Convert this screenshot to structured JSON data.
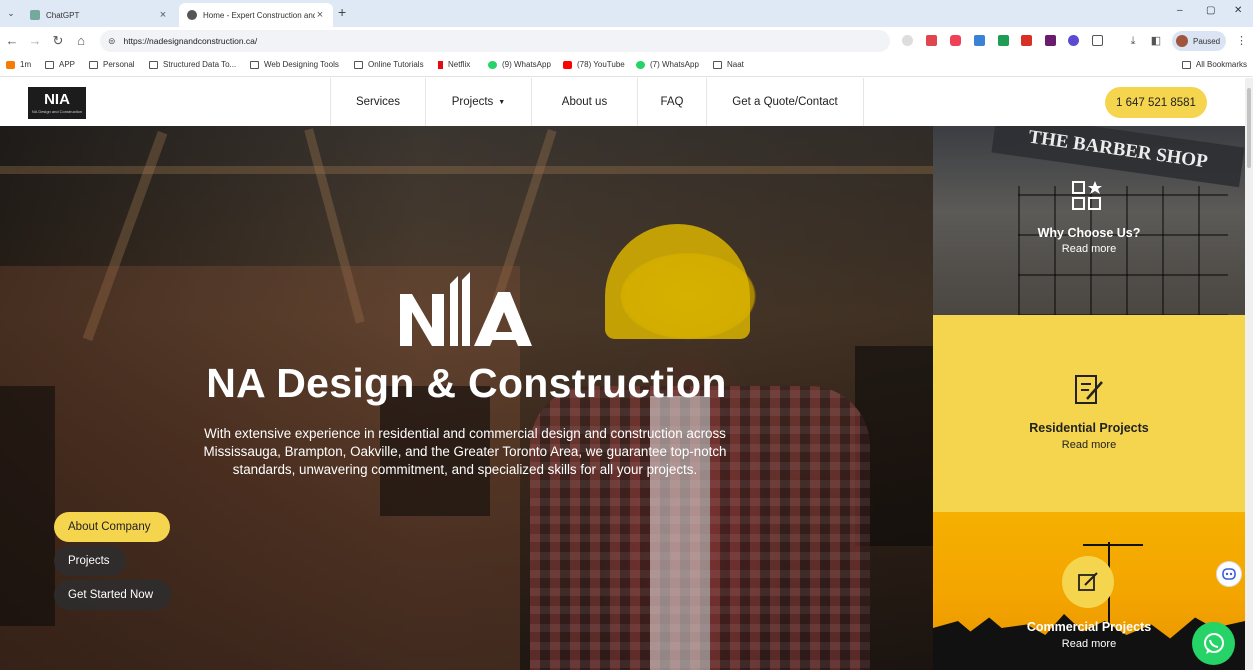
{
  "browser": {
    "tabs": [
      {
        "title": "ChatGPT",
        "close": "×"
      },
      {
        "title": "Home - Expert Construction and",
        "close": "×"
      }
    ],
    "new_tab": "+",
    "window_controls": {
      "minimize": "–",
      "maximize": "▢",
      "close": "✕"
    },
    "url": "https://nadesignandconstruction.ca/",
    "profile_status": "Paused",
    "bookmarks": [
      {
        "label": "1m",
        "icon": "orange-app-icon"
      },
      {
        "label": "APP",
        "icon": "folder-icon"
      },
      {
        "label": "Personal",
        "icon": "folder-icon"
      },
      {
        "label": "Structured Data To...",
        "icon": "folder-icon"
      },
      {
        "label": "Web Designing Tools",
        "icon": "folder-icon"
      },
      {
        "label": "Online Tutorials",
        "icon": "folder-icon"
      },
      {
        "label": "Netflix",
        "icon": "netflix-icon"
      },
      {
        "label": "(9) WhatsApp",
        "icon": "whatsapp-icon"
      },
      {
        "label": "(78) YouTube",
        "icon": "youtube-icon"
      },
      {
        "label": "(7) WhatsApp",
        "icon": "whatsapp-icon"
      },
      {
        "label": "Naat",
        "icon": "folder-icon"
      }
    ],
    "all_bookmarks": "All Bookmarks"
  },
  "site": {
    "logo_mark": "NIA",
    "logo_sub": "NA Design and Construction",
    "nav": [
      "Services",
      "Projects",
      "About us",
      "FAQ",
      "Get a Quote/Contact"
    ],
    "phone": "1 647 521 8581"
  },
  "hero": {
    "title": "NA Design & Construction",
    "description": "With extensive experience in residential and commercial design and construction across Mississauga, Brampton, Oakville, and the Greater Toronto Area, we guarantee top-notch standards, unwavering commitment, and specialized skills for all your projects.",
    "buttons": [
      "About Company",
      "Projects",
      "Get Started Now"
    ]
  },
  "side_cards": [
    {
      "title": "Why Choose Us?",
      "link": "Read more",
      "icon": "grid-star-icon",
      "sign": "THE BARBER SHOP"
    },
    {
      "title": "Residential Projects",
      "link": "Read more",
      "icon": "document-edit-icon"
    },
    {
      "title": "Commercial Projects",
      "link": "Read more",
      "icon": "edit-square-icon"
    }
  ],
  "colors": {
    "accent": "#f5d54e",
    "commercial_bg": "#f5b000",
    "whatsapp": "#25d366"
  }
}
